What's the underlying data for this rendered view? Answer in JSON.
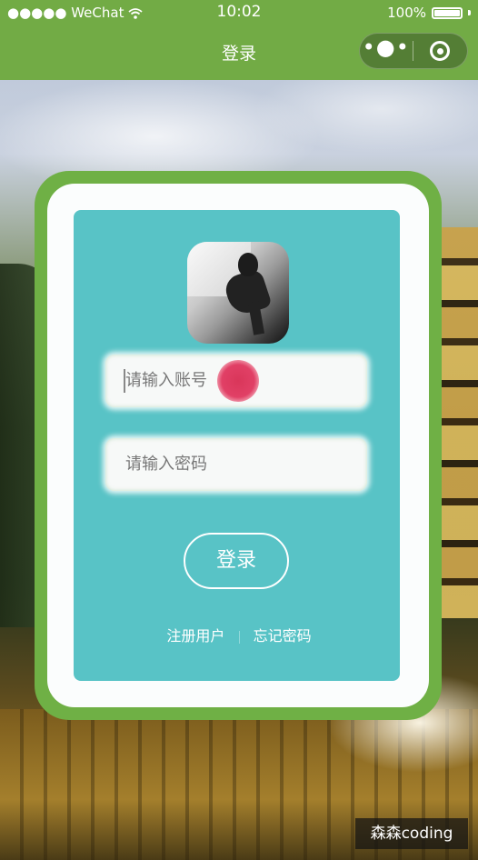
{
  "status_bar": {
    "carrier": "●●●●● WeChat",
    "wifi_icon": "wifi-icon",
    "time": "10:02",
    "battery": "100%"
  },
  "nav": {
    "title": "登录",
    "menu_glyph": "•●•",
    "capsule_close_icon": "record-circle-icon"
  },
  "login": {
    "account_placeholder": "请输入账号",
    "password_placeholder": "请输入密码",
    "login_button": "登录",
    "register_link": "注册用户",
    "forgot_link": "忘记密码"
  },
  "colors": {
    "nav_green": "#72ab45",
    "card_border_green": "#6fb045",
    "panel_teal": "#58c3c6",
    "touch_indicator": "#e14066"
  },
  "watermark": "森森coding"
}
